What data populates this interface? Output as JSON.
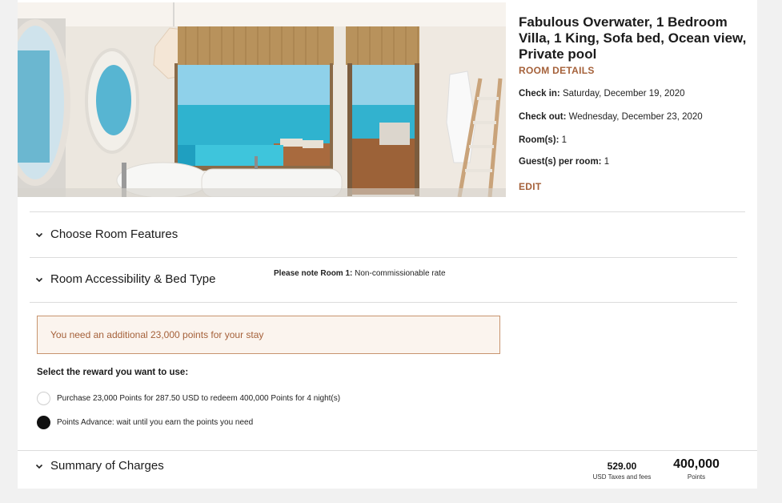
{
  "room": {
    "title": "Fabulous Overwater, 1 Bedroom Villa, 1 King, Sofa bed, Ocean view, Private pool",
    "details_link": "ROOM DETAILS",
    "check_in_label": "Check in:",
    "check_in_value": "Saturday, December 19, 2020",
    "check_out_label": "Check out:",
    "check_out_value": "Wednesday, December 23, 2020",
    "rooms_label": "Room(s):",
    "rooms_value": "1",
    "guests_label": "Guest(s) per room:",
    "guests_value": "1",
    "edit_link": "EDIT"
  },
  "accordions": {
    "room_features": "Choose Room Features",
    "accessibility": "Room Accessibility & Bed Type",
    "summary": "Summary of Charges"
  },
  "note": {
    "label": "Please note Room 1:",
    "text": "Non-commissionable rate"
  },
  "alert": {
    "text": "You need an additional 23,000 points for your stay"
  },
  "reward": {
    "heading": "Select the reward you want to use:",
    "options": [
      {
        "label": "Purchase 23,000 Points for 287.50 USD to redeem 400,000 Points for 4 night(s)",
        "selected": false
      },
      {
        "label": "Points Advance: wait until you earn the points you need",
        "selected": true
      }
    ]
  },
  "summary": {
    "taxes_amount": "529.00",
    "taxes_label": "USD Taxes and fees",
    "points_amount": "400,000",
    "points_label": "Points"
  },
  "colors": {
    "accent": "#a5613a",
    "alert_border": "#c8946e",
    "alert_bg": "#fbf4ee"
  },
  "icons": {
    "accordion": "chevron-down-icon",
    "radio_unchecked": "radio-unchecked",
    "radio_checked": "radio-checked"
  }
}
